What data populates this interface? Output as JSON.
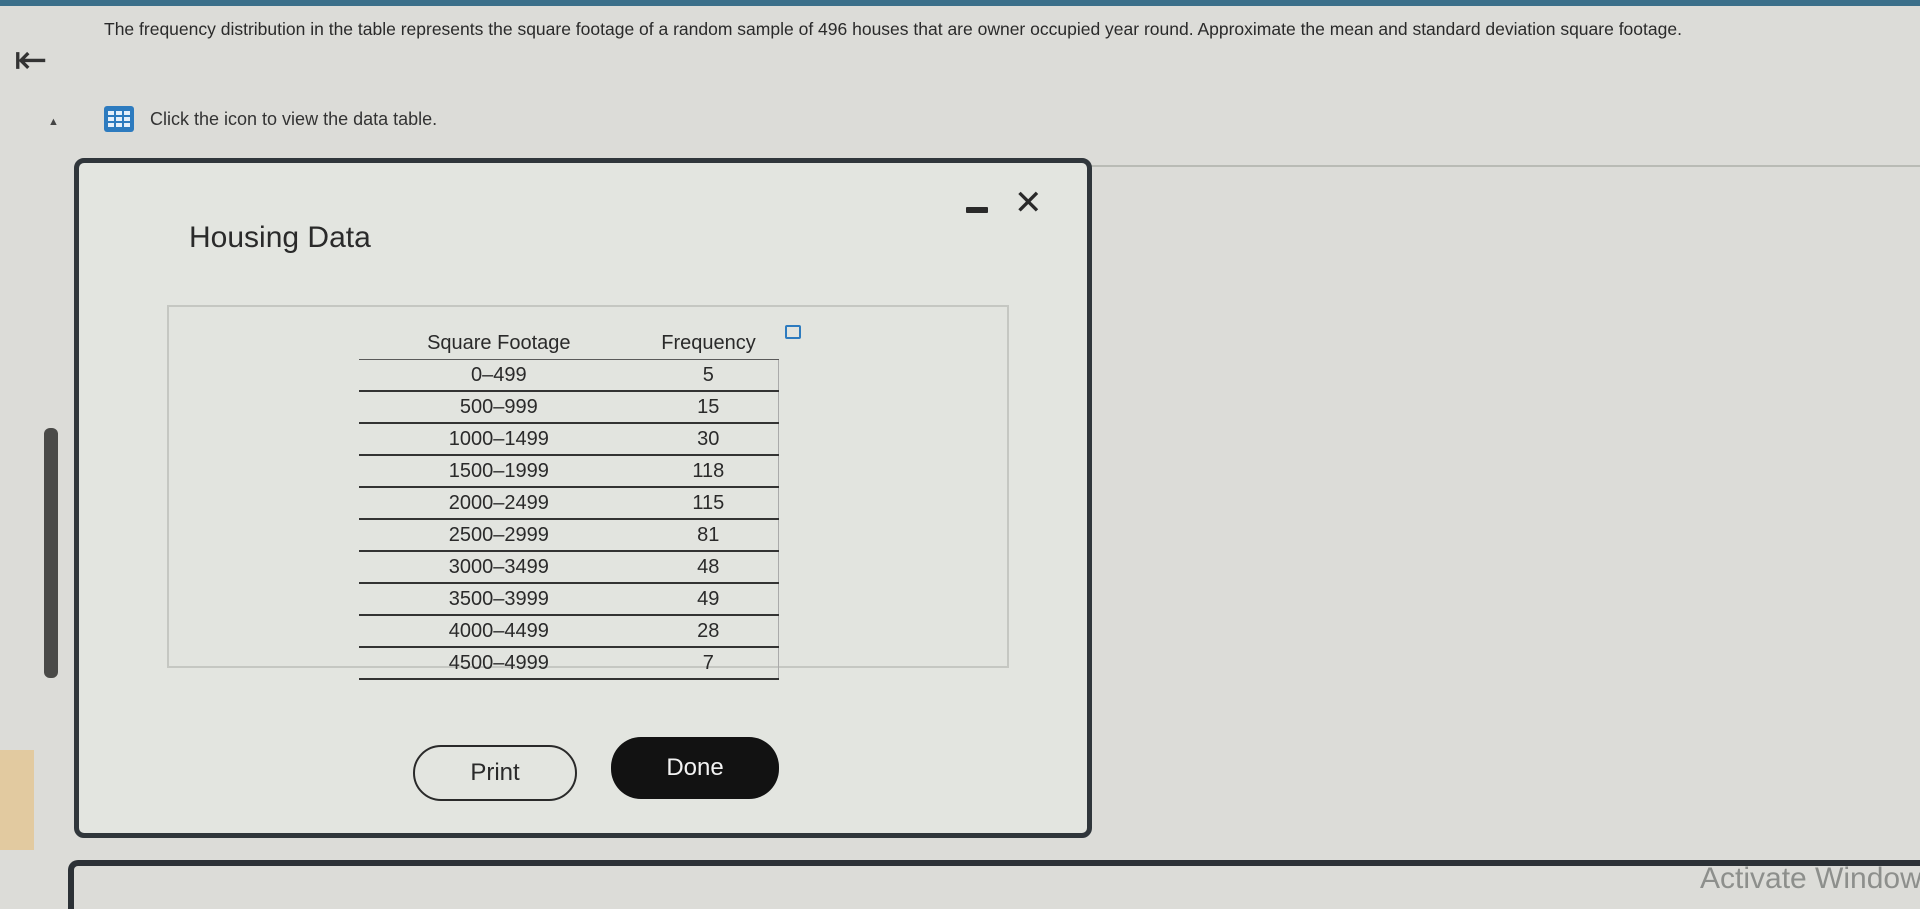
{
  "question": {
    "text": "The frequency distribution in the table represents the square footage of a random sample of 496 houses that are owner occupied year round. Approximate the mean and standard deviation square footage.",
    "data_prompt": "Click the icon to view the data table."
  },
  "dialog": {
    "title": "Housing Data",
    "columns": [
      "Square Footage",
      "Frequency"
    ],
    "rows": [
      {
        "range": "0–499",
        "freq": "5"
      },
      {
        "range": "500–999",
        "freq": "15"
      },
      {
        "range": "1000–1499",
        "freq": "30"
      },
      {
        "range": "1500–1999",
        "freq": "118"
      },
      {
        "range": "2000–2499",
        "freq": "115"
      },
      {
        "range": "2500–2999",
        "freq": "81"
      },
      {
        "range": "3000–3499",
        "freq": "48"
      },
      {
        "range": "3500–3999",
        "freq": "49"
      },
      {
        "range": "4000–4499",
        "freq": "28"
      },
      {
        "range": "4500–4999",
        "freq": "7"
      }
    ],
    "print_label": "Print",
    "done_label": "Done",
    "minimize_icon": "minimize-icon",
    "close_icon": "close-icon"
  },
  "watermark": "Activate Window",
  "colors": {
    "accent": "#2d7bbf",
    "done_bg": "#121212",
    "frame": "#30363b"
  }
}
